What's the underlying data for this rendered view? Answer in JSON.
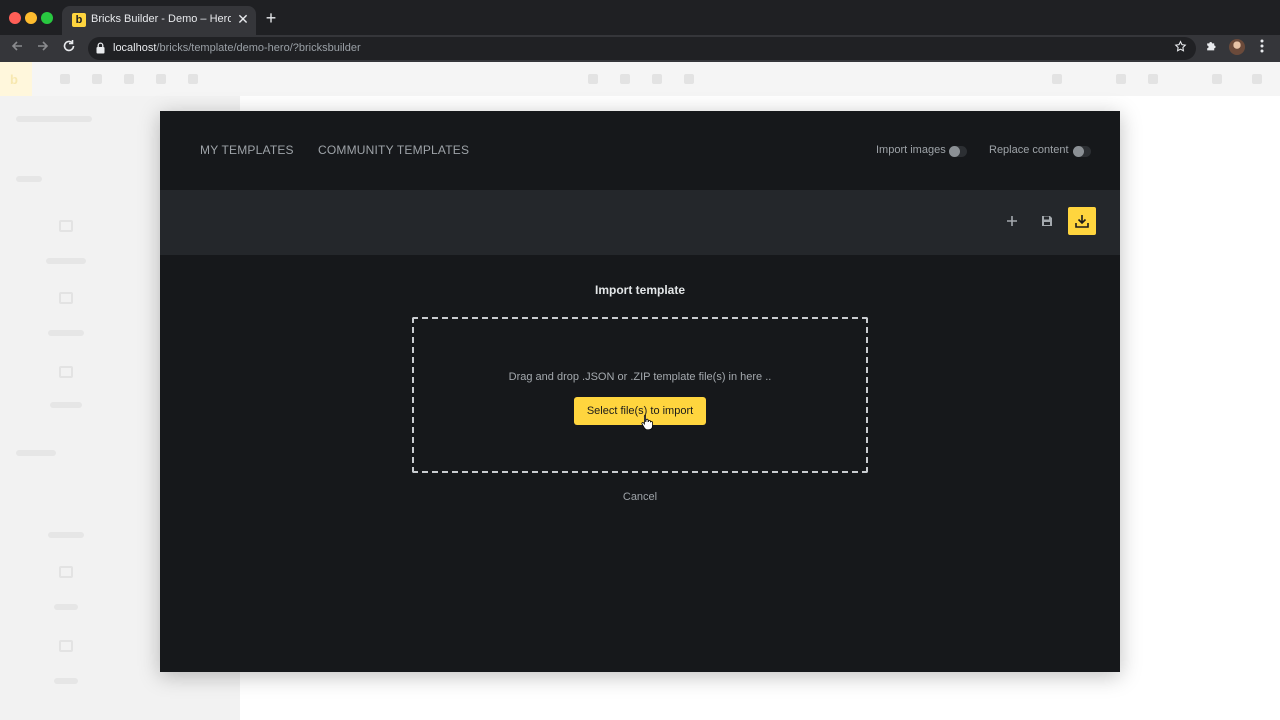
{
  "browser": {
    "tab_title": "Bricks Builder - Demo – Hero S",
    "favicon_letter": "b",
    "close_glyph": "✕",
    "new_tab_glyph": "+",
    "url_host": "localhost",
    "url_path": "/bricks/template/demo-hero/?bricksbuilder"
  },
  "modal": {
    "tabs": {
      "my_templates": "MY TEMPLATES",
      "community_templates": "COMMUNITY TEMPLATES"
    },
    "toggles": {
      "import_images": {
        "label": "Import images",
        "on": false
      },
      "replace_content": {
        "label": "Replace content",
        "on": false
      }
    },
    "actions": {
      "add_icon": "plus-icon",
      "save_icon": "save-icon",
      "import_icon": "download-icon"
    },
    "import": {
      "title": "Import template",
      "drop_text": "Drag and drop .JSON or .ZIP template file(s) in here ..",
      "select_button": "Select file(s) to import",
      "cancel": "Cancel"
    }
  },
  "colors": {
    "accent": "#ffd53e",
    "modal_bg": "#16181b",
    "actions_bg": "#24272b"
  }
}
